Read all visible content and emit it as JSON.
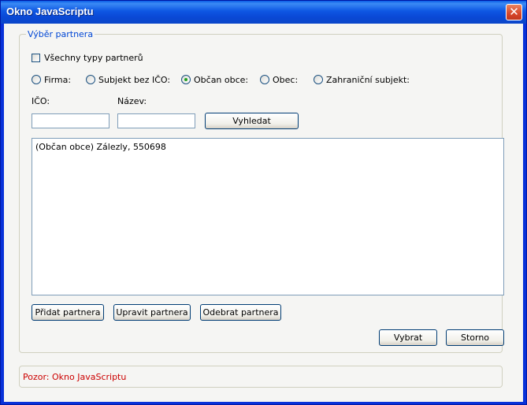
{
  "window": {
    "title": "Okno JavaScriptu"
  },
  "group": {
    "legend": "Výběr partnera"
  },
  "all_types": {
    "label": "Všechny typy partnerů",
    "checked": false
  },
  "partner_types": [
    {
      "label": "Firma:",
      "checked": false
    },
    {
      "label": "Subjekt bez IČO:",
      "checked": false
    },
    {
      "label": "Občan obce:",
      "checked": true
    },
    {
      "label": "Obec:",
      "checked": false
    },
    {
      "label": "Zahraniční subjekt:",
      "checked": false
    }
  ],
  "search": {
    "ico_label": "IČO:",
    "ico_value": "",
    "name_label": "Název:",
    "name_value": "",
    "search_button": "Vyhledat"
  },
  "results": [
    "(Občan obce) Zálezly, 550698"
  ],
  "actions": {
    "add": "Přidat partnera",
    "edit": "Upravit partnera",
    "remove": "Odebrat partnera"
  },
  "dialog_buttons": {
    "select": "Vybrat",
    "cancel": "Storno"
  },
  "status": {
    "text": "Pozor: Okno JavaScriptu"
  }
}
